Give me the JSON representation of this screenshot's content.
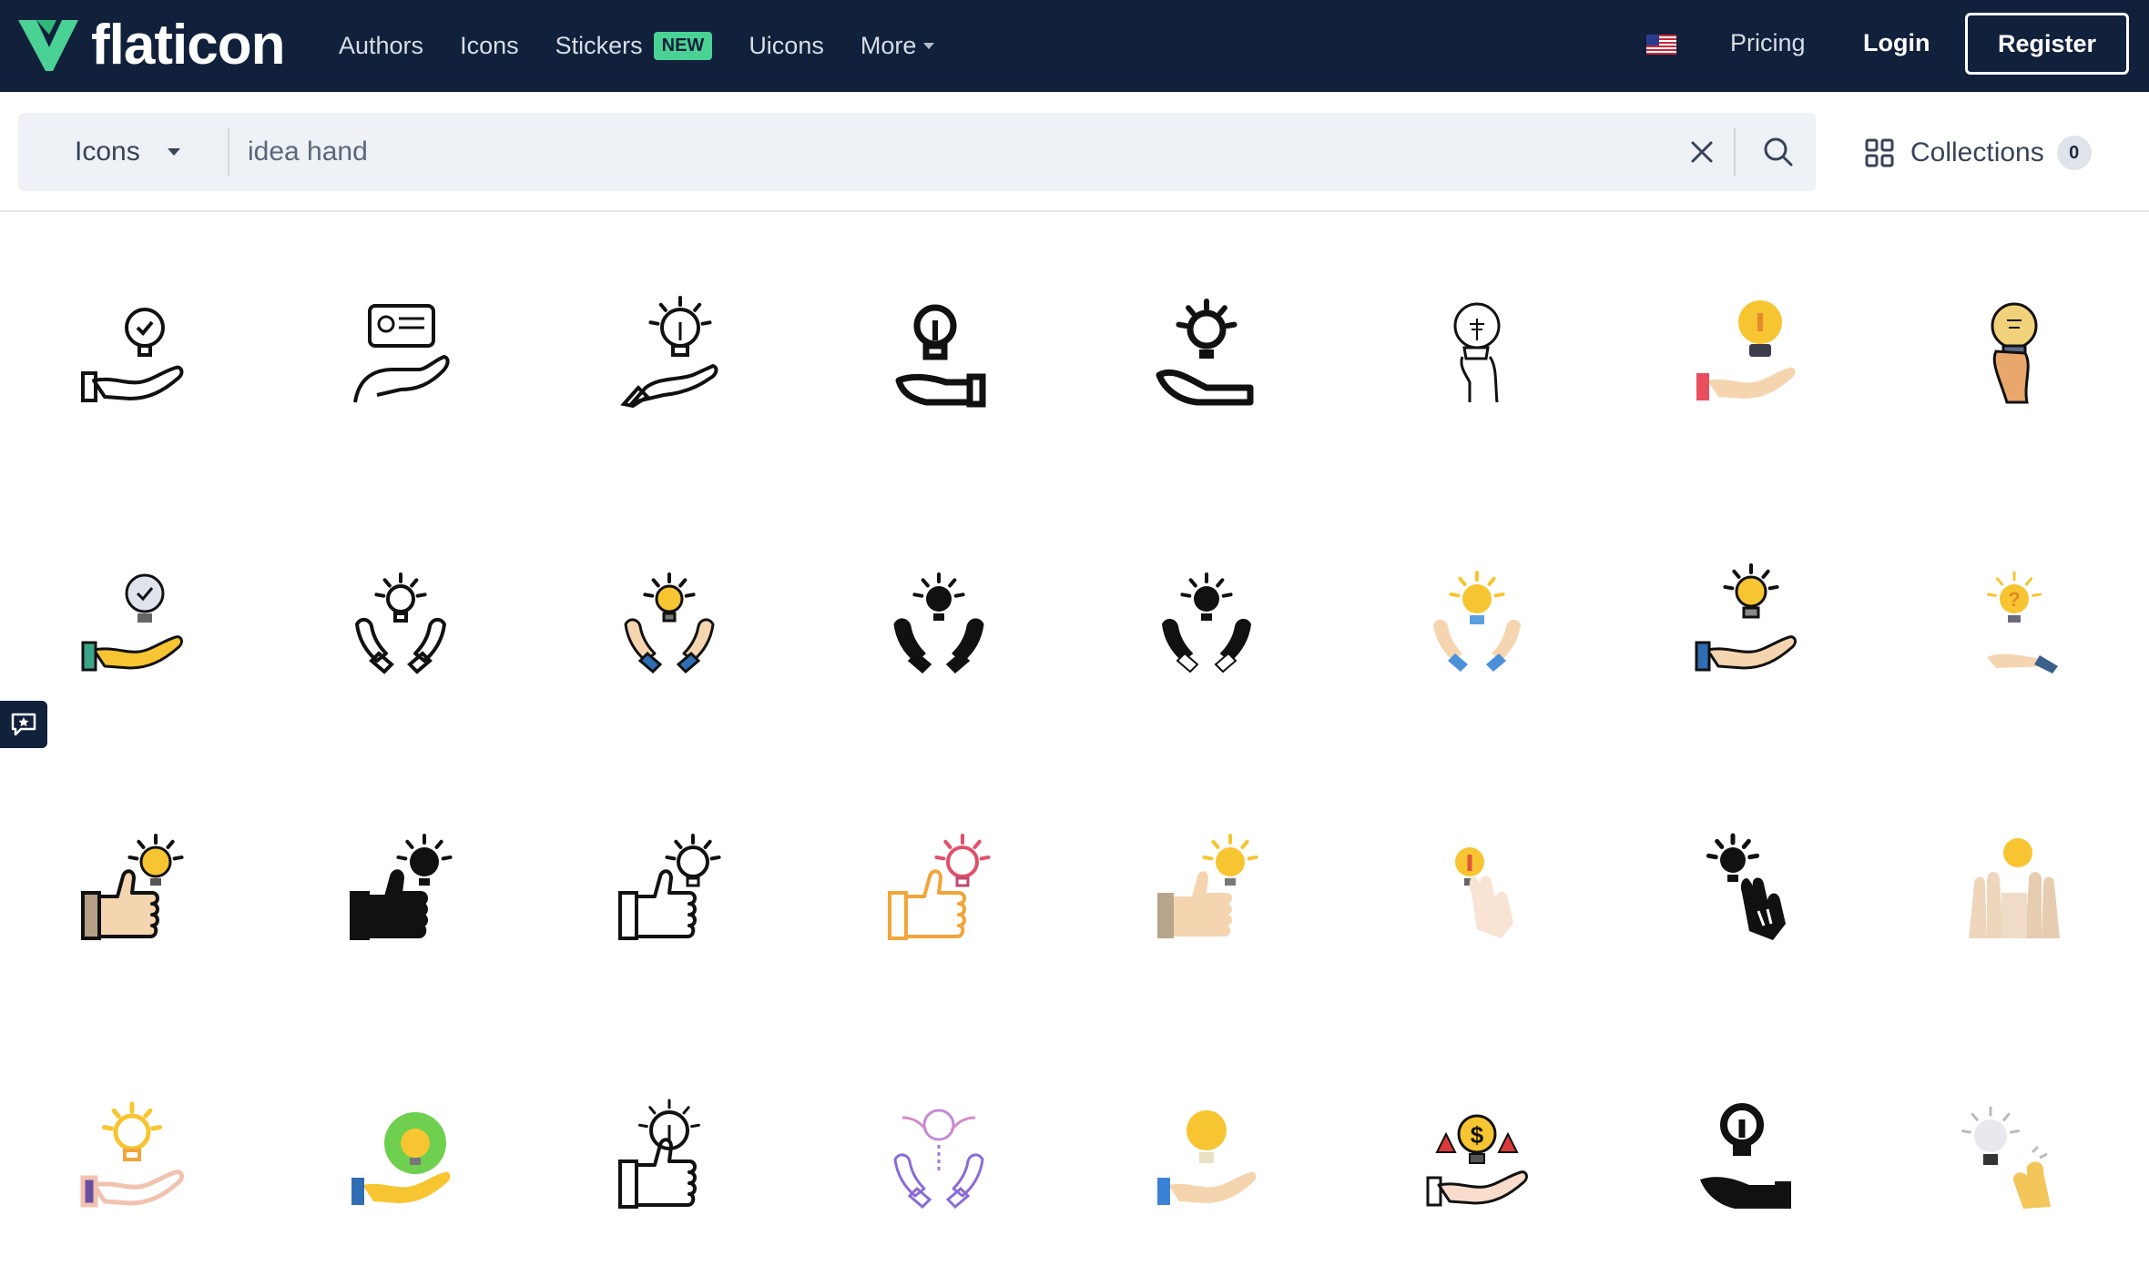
{
  "header": {
    "logo_text": "flaticon",
    "nav": [
      {
        "label": "Authors"
      },
      {
        "label": "Icons"
      },
      {
        "label": "Stickers",
        "badge": "NEW"
      },
      {
        "label": "Uicons"
      },
      {
        "label": "More"
      }
    ],
    "pricing_label": "Pricing",
    "login_label": "Login",
    "register_label": "Register"
  },
  "search": {
    "type_label": "Icons",
    "query": "idea hand"
  },
  "collections": {
    "label": "Collections",
    "count": "0"
  },
  "colors": {
    "nav_bg": "#11203b",
    "accent_green": "#4ad295",
    "bulb_yellow": "#f7c531",
    "skin": "#f5d5b0"
  },
  "icons": [
    "hand-bulb-check-outline-icon",
    "hand-chat-idea-outline-icon",
    "hand-bulb-pencil-outline-icon",
    "hand-bulb-bold-outline-icon",
    "hand-bulb-rays-bold-icon",
    "hand-holding-bulb-sketch-icon",
    "hand-bulb-color-red-cuff-icon",
    "hand-holding-bulb-color-icon",
    "hand-bulb-check-color-icon",
    "two-hands-bulb-outline-icon",
    "two-hands-bulb-color-icon",
    "two-hands-bulb-solid-icon",
    "two-hands-bulb-solid-alt-icon",
    "two-hands-bulb-flat-icon",
    "hand-bulb-rays-color-icon",
    "hand-bulb-question-flat-icon",
    "thumbs-up-bulb-color-icon",
    "thumbs-up-bulb-solid-icon",
    "thumbs-up-bulb-outline-icon",
    "thumbs-up-bulb-gradient-icon",
    "thumbs-up-bulb-flat-icon",
    "peace-hand-bulb-flat-icon",
    "peace-hand-bulb-solid-icon",
    "two-palms-bulb-flat-icon",
    "hand-bulb-purple-outline-icon",
    "hand-bulb-green-circle-icon",
    "fist-bulb-rays-outline-icon",
    "hands-bulb-wings-gradient-icon",
    "hand-bulb-yellow-flat-icon",
    "hand-bulb-dollar-arrows-icon",
    "hand-bulb-solid-black-icon",
    "crossed-fingers-bulb-icon"
  ]
}
